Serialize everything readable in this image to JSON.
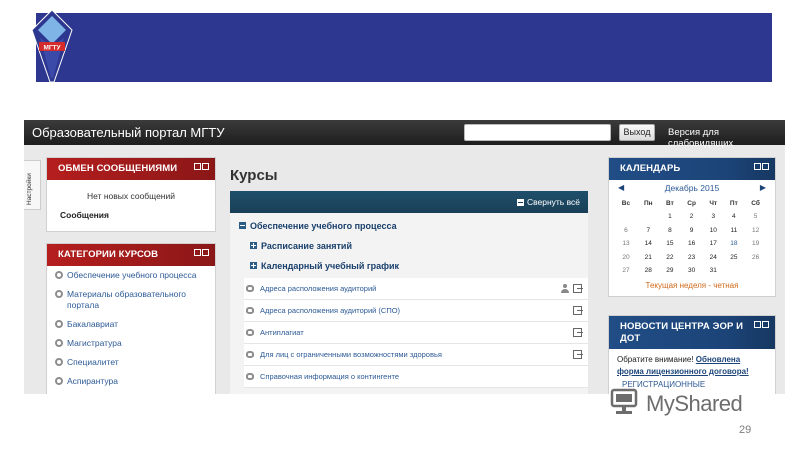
{
  "slide": {
    "banner_color": "#2e3790",
    "logo_text": "МГТУ",
    "page_number": "29"
  },
  "portal": {
    "title": "Образовательный портал МГТУ",
    "search": {
      "placeholder": "",
      "button_label": "Выход"
    },
    "impaired_link": "Версия для слабовидящих",
    "settings_tab": "Настройки"
  },
  "messages_block": {
    "title": "ОБМЕН СООБЩЕНИЯМИ",
    "empty_text": "Нет новых сообщений",
    "messages_link": "Сообщения"
  },
  "categories_block": {
    "title": "КАТЕГОРИИ КУРСОВ",
    "items": [
      "Обеспечение учебного процесса",
      "Материалы образовательного портала",
      "Бакалавриат",
      "Магистратура",
      "Специалитет",
      "Аспирантура"
    ]
  },
  "courses": {
    "title": "Курсы",
    "collapse_all": "Свернуть всё",
    "sections": [
      {
        "label": "Обеспечение учебного процесса",
        "expanded": true
      },
      {
        "label": "Расписание занятий",
        "expanded": false
      },
      {
        "label": "Календарный учебный график",
        "expanded": false
      }
    ],
    "resources": [
      "Адреса расположения аудиторий",
      "Адреса расположения аудиторий (СПО)",
      "Антиплагиат",
      "Для лиц с ограниченными возможностями здоровья",
      "Справочная информация о контингенте"
    ]
  },
  "calendar": {
    "title": "КАЛЕНДАРЬ",
    "month": "Декабрь 2015",
    "prev_icon": "triangle-left",
    "next_icon": "triangle-right",
    "weekdays": [
      "Вс",
      "Пн",
      "Вт",
      "Ср",
      "Чт",
      "Пт",
      "Сб"
    ],
    "weeks": [
      [
        "",
        "",
        "1",
        "2",
        "3",
        "4",
        "5"
      ],
      [
        "6",
        "7",
        "8",
        "9",
        "10",
        "11",
        "12"
      ],
      [
        "13",
        "14",
        "15",
        "16",
        "17",
        "18",
        "19"
      ],
      [
        "20",
        "21",
        "22",
        "23",
        "24",
        "25",
        "26"
      ],
      [
        "27",
        "28",
        "29",
        "30",
        "31",
        "",
        ""
      ]
    ],
    "footer": "Текущая неделя - четная"
  },
  "news_block": {
    "title_line1": "НОВОСТИ ЦЕНТРА ЭОР И",
    "title_line2": "ДОТ",
    "text_prefix": "Обратите внимание!",
    "link_line1": "Обновлена",
    "link_line2": "форма лицензионного договора!",
    "registration": "РЕГИСТРАЦИОННЫЕ"
  },
  "watermark": {
    "text": "MyShared"
  }
}
